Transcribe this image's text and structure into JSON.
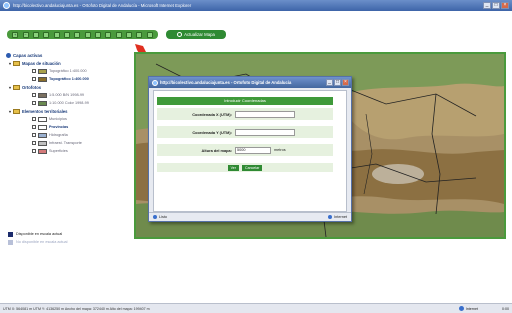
{
  "window": {
    "title": "http://bicolectivo.andaluciajunta.es - Ortofoto Digital de Andalucía - Microsoft Internet Explorer",
    "controls": [
      "_",
      "□",
      "×"
    ]
  },
  "toolbar": {
    "tools": [
      "zoom-in",
      "zoom-out",
      "select",
      "pan",
      "identify",
      "measure",
      "grid",
      "refresh",
      "home",
      "print",
      "help",
      "info",
      "coordinates",
      "filter"
    ],
    "update_label": "Actualizar Mapa"
  },
  "sidebar": {
    "active_layers_title": "Capas activas",
    "groups": [
      {
        "title": "Mapas de situación",
        "items": [
          {
            "label": "Topográfico 1:400.000",
            "bold": false,
            "swatch": "#a8a04a"
          },
          {
            "label": "Topográfico 1:400.000",
            "bold": true,
            "swatch": "#8a6e2a"
          }
        ]
      },
      {
        "title": "Ortofotos",
        "items": [
          {
            "label": "1:5.000 B/N 1998-99",
            "bold": false,
            "swatch": "#7a7060"
          },
          {
            "label": "1:10.000 Color 1998-99",
            "bold": false,
            "swatch": "#6a8a50"
          }
        ]
      },
      {
        "title": "Elementos territoriales",
        "items": [
          {
            "label": "Municipios",
            "bold": false,
            "swatch": "#ffffff"
          },
          {
            "label": "Provincias",
            "bold": true,
            "swatch": "#ffffff"
          },
          {
            "label": "Hidrografía",
            "bold": false,
            "swatch": "#9ab0d0"
          },
          {
            "label": "Infraest. Transporte",
            "bold": false,
            "swatch": "#c0c0c0"
          },
          {
            "label": "Superficies",
            "bold": false,
            "swatch": "#d47a7a"
          }
        ]
      }
    ]
  },
  "legend": [
    {
      "label": "Disponible en escala actual",
      "color": "#1c2c6c"
    },
    {
      "label": "No disponible en escala actual",
      "color": "#b8c0d8"
    }
  ],
  "dialog": {
    "title": "http://bicolectivo.andaluciajunta.es - Ortofoto Digital de Andalucía",
    "header": "Introducir Coordenadas",
    "fields": [
      {
        "label": "Coordenada X (UTM):",
        "value": ""
      },
      {
        "label": "Coordenada Y (UTM):",
        "value": ""
      },
      {
        "label": "Altura del mapa:",
        "value": "5000",
        "unit": "metros"
      }
    ],
    "buttons": [
      "Ver",
      "Cancelar"
    ],
    "status_left": "Listo",
    "status_right": "Internet"
  },
  "statusbar": {
    "text": "UTM X: 564081 m    UTM Y: 4136250 m    Ancho del mapa: 372440 m    Alto del mapa: 199407 m",
    "zone": "Internet",
    "time": "0:00"
  },
  "colors": {
    "accent_green": "#4a9a3c",
    "title_blue": "#43679f",
    "red_arrow": "#e03020"
  }
}
